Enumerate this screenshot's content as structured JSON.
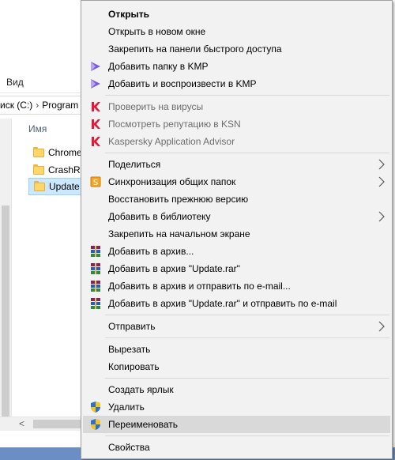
{
  "explorer": {
    "ribbon_tab": "Вид",
    "address": {
      "drive": "иск (C:)",
      "separator": "›",
      "folder": "Program"
    },
    "column_header": "Имя",
    "files": [
      {
        "name": "Chrome",
        "selected": false
      },
      {
        "name": "CrashRe",
        "selected": false
      },
      {
        "name": "Update",
        "selected": true
      }
    ],
    "scroll_left_arrow": "<"
  },
  "menu": {
    "items": [
      {
        "label": "Открыть",
        "bold": true,
        "icon": ""
      },
      {
        "label": "Открыть в новом окне",
        "icon": ""
      },
      {
        "label": "Закрепить на панели быстрого доступа",
        "icon": ""
      },
      {
        "label": "Добавить папку в KMP",
        "icon": "kmplayer-icon"
      },
      {
        "label": "Добавить и воспроизвести в KMP",
        "icon": "kmplayer-icon"
      },
      {
        "label": "Проверить на вирусы",
        "icon": "kaspersky-icon",
        "disabled": true
      },
      {
        "label": "Посмотреть репутацию в KSN",
        "icon": "kaspersky-icon",
        "disabled": true
      },
      {
        "label": "Kaspersky Application Advisor",
        "icon": "kaspersky-icon",
        "disabled": true
      },
      {
        "label": "Поделиться",
        "icon": "",
        "submenu": true
      },
      {
        "label": "Синхронизация общих папок",
        "icon": "sync-folders-icon",
        "submenu": true
      },
      {
        "label": "Восстановить прежнюю версию",
        "icon": ""
      },
      {
        "label": "Добавить в библиотеку",
        "icon": "",
        "submenu": true
      },
      {
        "label": "Закрепить на начальном экране",
        "icon": ""
      },
      {
        "label": "Добавить в архив...",
        "icon": "winrar-icon"
      },
      {
        "label": "Добавить в архив \"Update.rar\"",
        "icon": "winrar-icon"
      },
      {
        "label": "Добавить в архив и отправить по e-mail...",
        "icon": "winrar-icon"
      },
      {
        "label": "Добавить в архив \"Update.rar\" и отправить по e-mail",
        "icon": "winrar-icon"
      },
      {
        "label": "Отправить",
        "icon": "",
        "submenu": true
      },
      {
        "label": "Вырезать",
        "icon": ""
      },
      {
        "label": "Копировать",
        "icon": ""
      },
      {
        "label": "Создать ярлык",
        "icon": ""
      },
      {
        "label": "Удалить",
        "icon": "uac-shield-icon"
      },
      {
        "label": "Переименовать",
        "icon": "uac-shield-icon",
        "highlighted": true
      },
      {
        "label": "Свойства",
        "icon": ""
      }
    ]
  },
  "colors": {
    "menu_bg": "#f2f2f2",
    "highlight": "#d9d9d9",
    "selection": "#cce8ff",
    "disabled_text": "#6d6d6d",
    "kmp_purple": "#7b5bd6",
    "kaspersky_red": "#e0183a"
  }
}
